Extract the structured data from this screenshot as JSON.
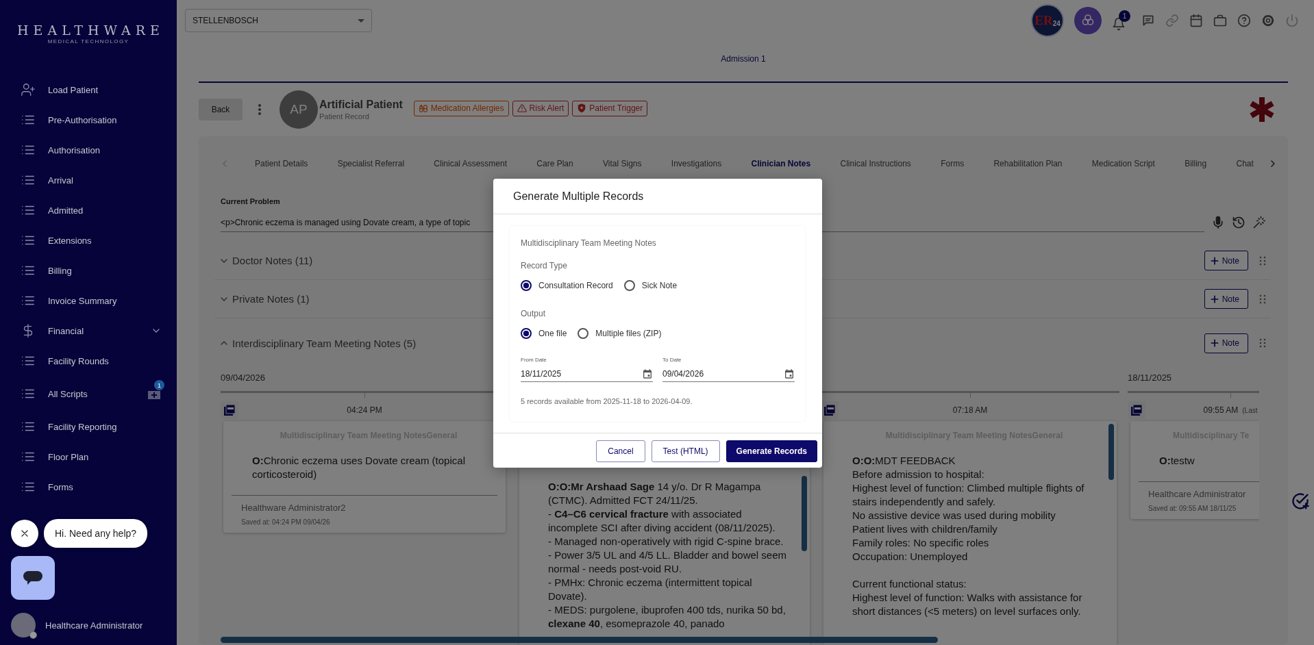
{
  "sidebar": {
    "logo": {
      "title": "HEALTHWARE",
      "subtitle": "MEDICAL TECHNOLOGY"
    },
    "items": [
      {
        "label": "Load Patient",
        "kind": "user-add"
      },
      {
        "label": "Pre-Authorisation",
        "kind": "list"
      },
      {
        "label": "Authorisation",
        "kind": "list"
      },
      {
        "label": "Arrival",
        "kind": "list"
      },
      {
        "label": "Admitted",
        "kind": "list"
      },
      {
        "label": "Extensions",
        "kind": "list"
      },
      {
        "label": "Billing",
        "kind": "list"
      },
      {
        "label": "Invoice Summary",
        "kind": "list"
      },
      {
        "label": "Financial",
        "kind": "dollar",
        "expandable": true
      },
      {
        "label": "Facility Rounds",
        "kind": "list"
      },
      {
        "label": "All Scripts",
        "kind": "list",
        "badge": "1"
      },
      {
        "label": "Facility Reporting",
        "kind": "list"
      },
      {
        "label": "Floor Plan",
        "kind": "list"
      },
      {
        "label": "Forms",
        "kind": "list"
      }
    ],
    "user": {
      "name": "Healthcare Administrator"
    }
  },
  "topbar": {
    "location": "STELLENBOSCH",
    "logo_badge": {
      "main": "ER",
      "sub": "24"
    },
    "notification_count": "1"
  },
  "admission_tabs": [
    {
      "label": "Admission 1",
      "selected": true
    }
  ],
  "patient": {
    "back": "Back",
    "initials": "AP",
    "name": "Artificial Patient",
    "subtitle": "Patient Record",
    "alerts": [
      {
        "label": "Medication Allergies",
        "kind": "pill"
      },
      {
        "label": "Risk Alert",
        "kind": "warning"
      },
      {
        "label": "Patient Trigger",
        "kind": "shield"
      }
    ]
  },
  "tabs": [
    {
      "label": "Patient Details",
      "selected": false
    },
    {
      "label": "Specialist Referral",
      "selected": false
    },
    {
      "label": "Clinical Assessment",
      "selected": false
    },
    {
      "label": "Care Plan",
      "selected": false
    },
    {
      "label": "Vital Signs",
      "selected": false
    },
    {
      "label": "Investigations",
      "selected": false
    },
    {
      "label": "Clinician Notes",
      "selected": true
    },
    {
      "label": "Clinical Instructions",
      "selected": false
    },
    {
      "label": "Forms",
      "selected": false
    },
    {
      "label": "Rehabilitation Plan",
      "selected": false
    },
    {
      "label": "Medication Script",
      "selected": false
    },
    {
      "label": "Billing",
      "selected": false
    },
    {
      "label": "Chat",
      "selected": false
    }
  ],
  "current_problem": {
    "label": "Current Problem",
    "value": "<p>Chronic eczema is managed using Dovate cream, a type of topic"
  },
  "sections": [
    {
      "title": "Doctor Notes (11)",
      "expanded": false,
      "button": "Note"
    },
    {
      "title": "Private Notes (1)",
      "expanded": false,
      "button": "Note"
    },
    {
      "title": "Interdisciplinary Team Meeting Notes (5)",
      "expanded": true,
      "button": "Note"
    }
  ],
  "timeline": [
    {
      "date": "09/04/2026",
      "time": "04:24 PM",
      "title": "Multidisciplinary Team Meeting NotesGeneral",
      "body": [
        [
          "**O:**Chronic eczema uses Dovate cream (topical corticosteroid)"
        ]
      ],
      "author": "Healthware Administrator2",
      "saved": "Saved at: 04:24 PM 09/04/26"
    },
    {
      "body": [
        [
          "**O:O:Mr Arshaad Sage** 14 y/o. Dr R Magampa (CTMC). Admitted FCT 24/11/25.",
          "- **C4–C6 cervical fracture** with associated incomplete SCI after diving accident (08/11/2025).",
          "- Managed non-operatively with rigid C-spine brace.",
          "- Power 3/5 UL and 4/5 LL. Bladder and bowel seem normal - needs post-void RU.",
          "- PMHx: Chronic eczema (intermittent topical Dovate).",
          "- MEDS: purgolene, ibuprofen 400 tds, nurika 50 bd, **clexane 40**, esomeprazole 40, panado"
        ]
      ]
    },
    {
      "time": "07:18 AM",
      "title": "Multidisciplinary Team Meeting NotesGeneral",
      "body": [
        [
          "**O:O:**MDT FEEDBACK",
          "Before admission to hospital:",
          "Highest level of function: Climbed multiple flights of stairs independently and safely.",
          "No assistive device was used during mobility",
          "Patient lives with children/family",
          "Family roles: No specific roles",
          "Occupation: Unemployed"
        ],
        [
          "Current functional status:",
          "Highest level of function: Walks with assistance for short distances (<5 meters) on level surfaces only."
        ]
      ]
    },
    {
      "date": "18/11/2025",
      "time": "09:55 AM",
      "note": "(Last",
      "title": "Multidisciplinary Te",
      "body": [
        [
          "**O:**testw"
        ]
      ],
      "author": "Healthcare Administrator",
      "saved": "Saved at: 09:55 AM 18/11/25"
    }
  ],
  "modal": {
    "title": "Generate Multiple Records",
    "section": "Multidisciplinary Team Meeting Notes",
    "groups": [
      {
        "label": "Record Type",
        "options": [
          {
            "label": "Consultation Record",
            "selected": true
          },
          {
            "label": "Sick Note",
            "selected": false
          }
        ]
      },
      {
        "label": "Output",
        "options": [
          {
            "label": "One file",
            "selected": true
          },
          {
            "label": "Multiple files (ZIP)",
            "selected": false
          }
        ]
      }
    ],
    "dates": [
      {
        "label": "From Date",
        "value": "18/11/2025"
      },
      {
        "label": "To Date",
        "value": "09/04/2026"
      }
    ],
    "info": "5 records available from 2025-11-18 to 2026-04-09.",
    "buttons": [
      {
        "label": "Cancel",
        "kind": "outline"
      },
      {
        "label": "Test (HTML)",
        "kind": "outline"
      },
      {
        "label": "Generate Records",
        "kind": "primary"
      }
    ]
  },
  "chat": {
    "message": "Hi. Need any help?"
  }
}
